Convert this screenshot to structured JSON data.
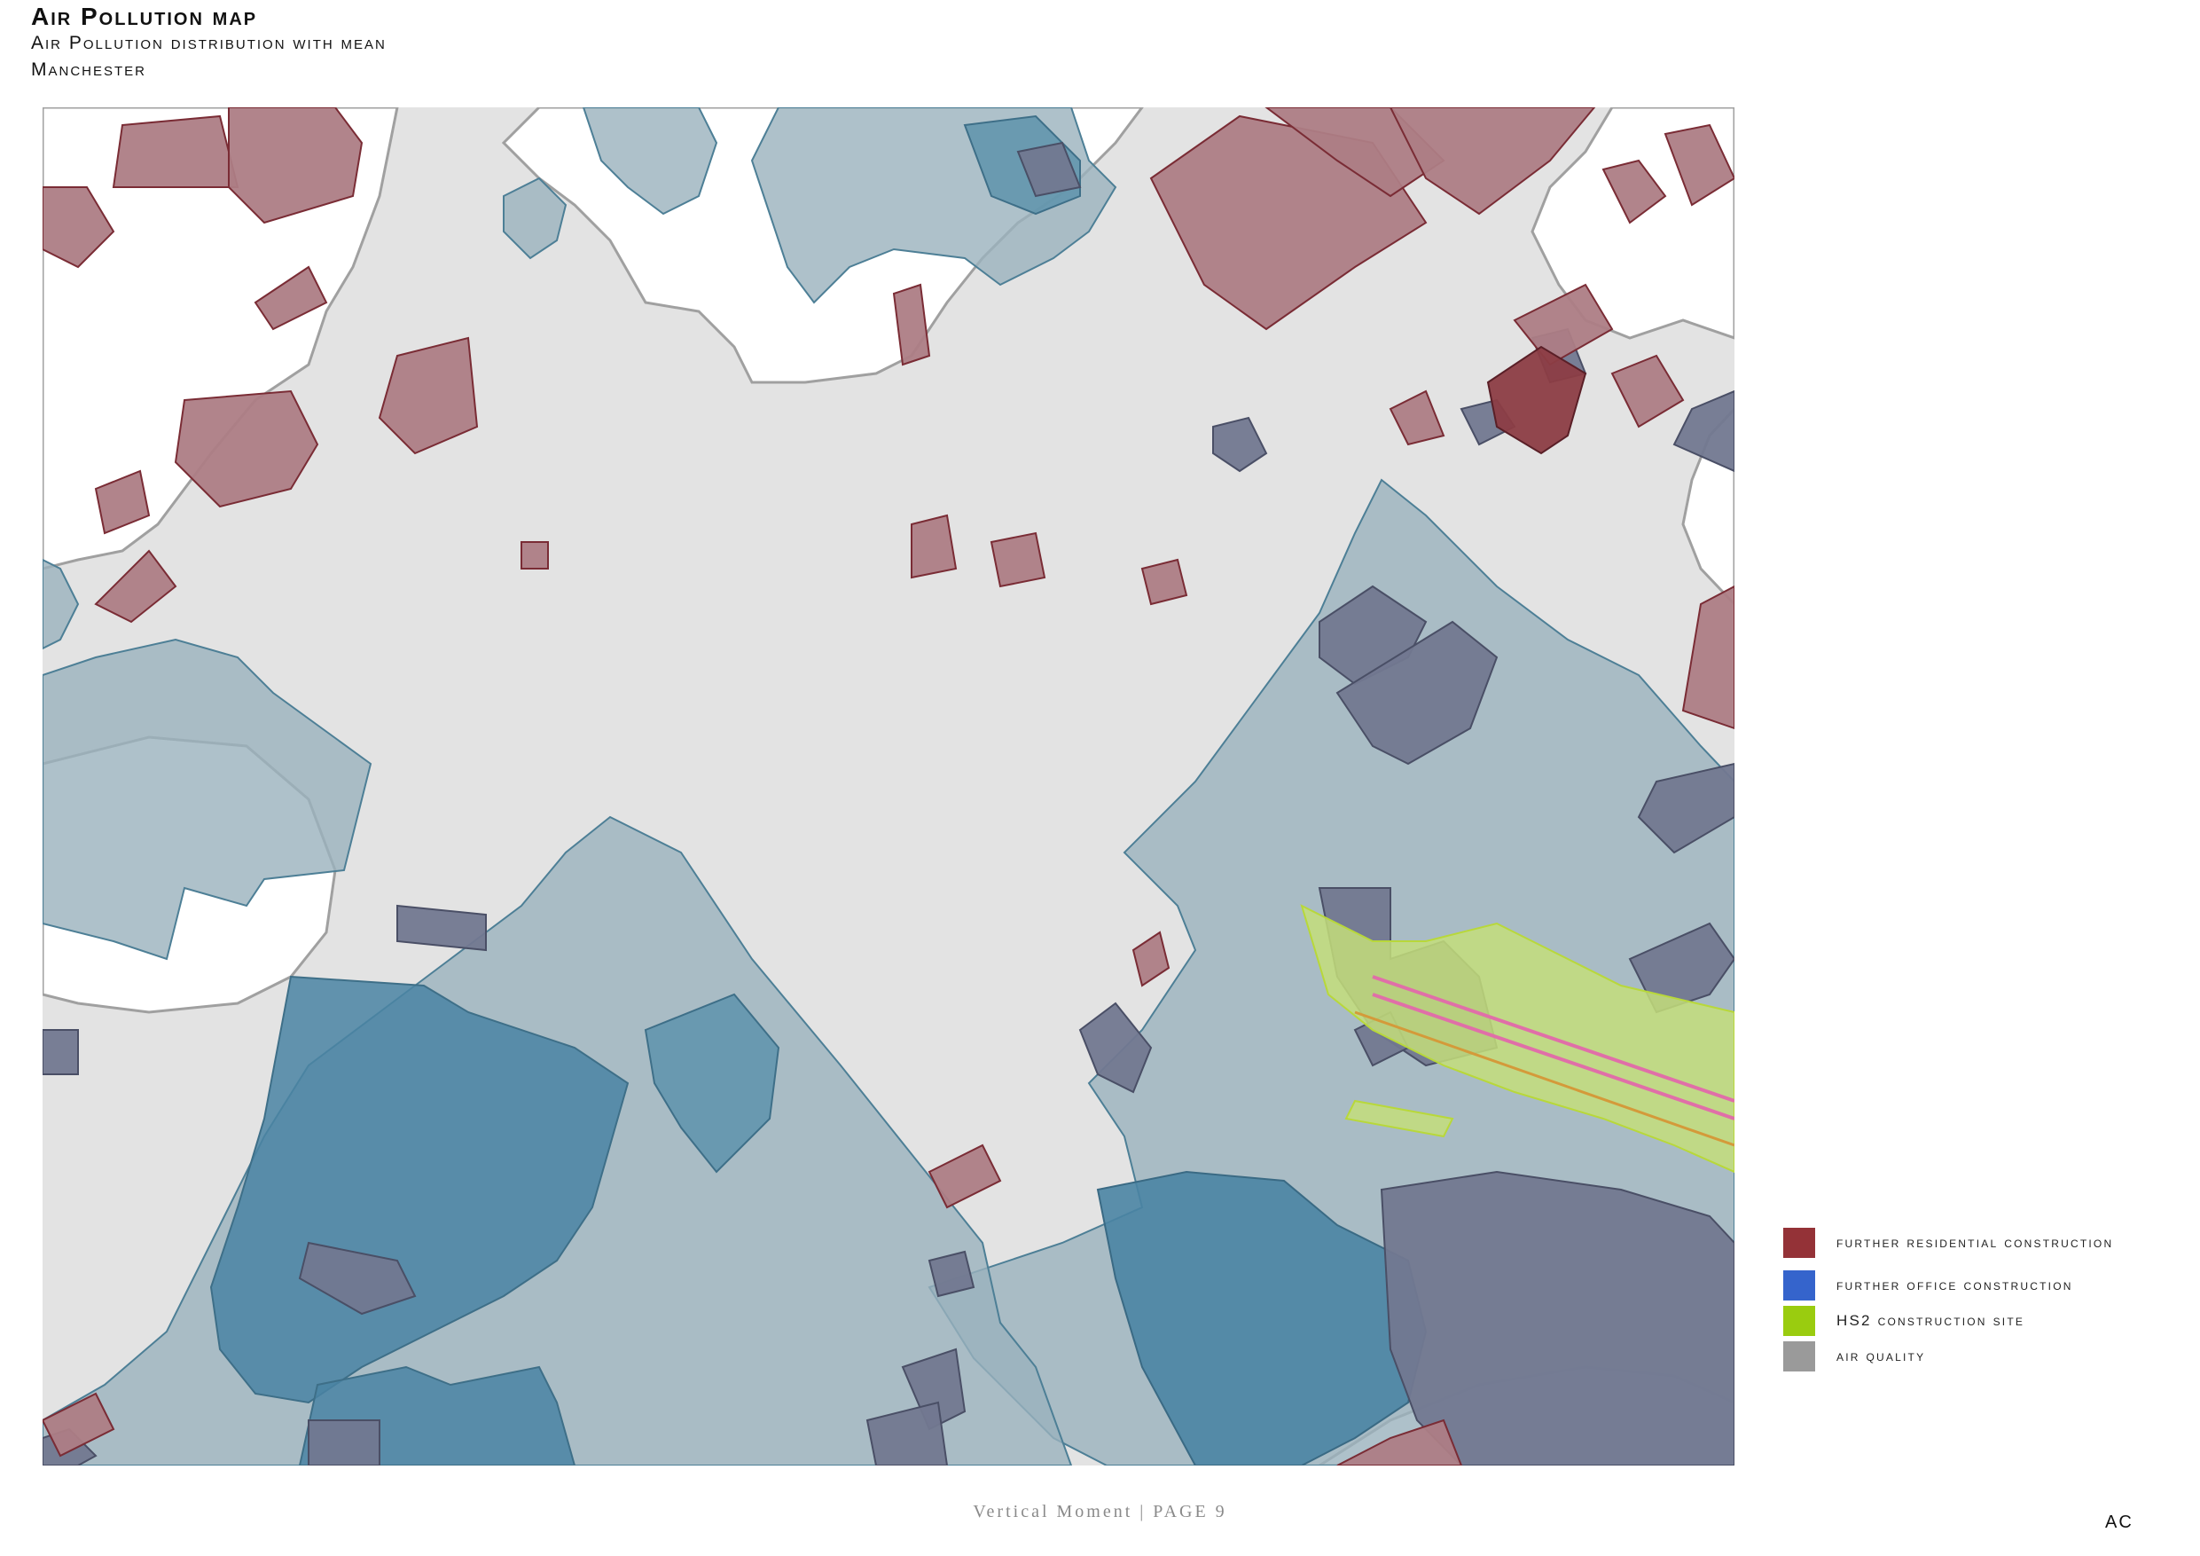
{
  "header": {
    "title": "Air Pollution map",
    "subtitle": "Air Pollution distribution with mean",
    "city": "Manchester"
  },
  "legend": {
    "items": [
      {
        "label": "further residential construction",
        "color": "#943237"
      },
      {
        "label": "further office construction",
        "color": "#3564cc"
      },
      {
        "label": "HS2 construction site",
        "color": "#9acc0f"
      },
      {
        "label": "air quality",
        "color": "#9a9a9a"
      }
    ]
  },
  "map_colors": {
    "background": "#e3e3e3",
    "white_area": "#ffffff",
    "air_quality_zone": "#9ab2bd",
    "air_quality_dense": "#5e93ab",
    "air_quality_darkest": "#4a84a3",
    "office_building": "#727890",
    "residential_building": "#ad7d85",
    "residential_new": "#8c3d45",
    "hs2_site": "#c4de7a",
    "hs2_track": "#e06fa8"
  },
  "footer": {
    "text": "Vertical Moment | PAGE 9",
    "initials": "AC"
  }
}
